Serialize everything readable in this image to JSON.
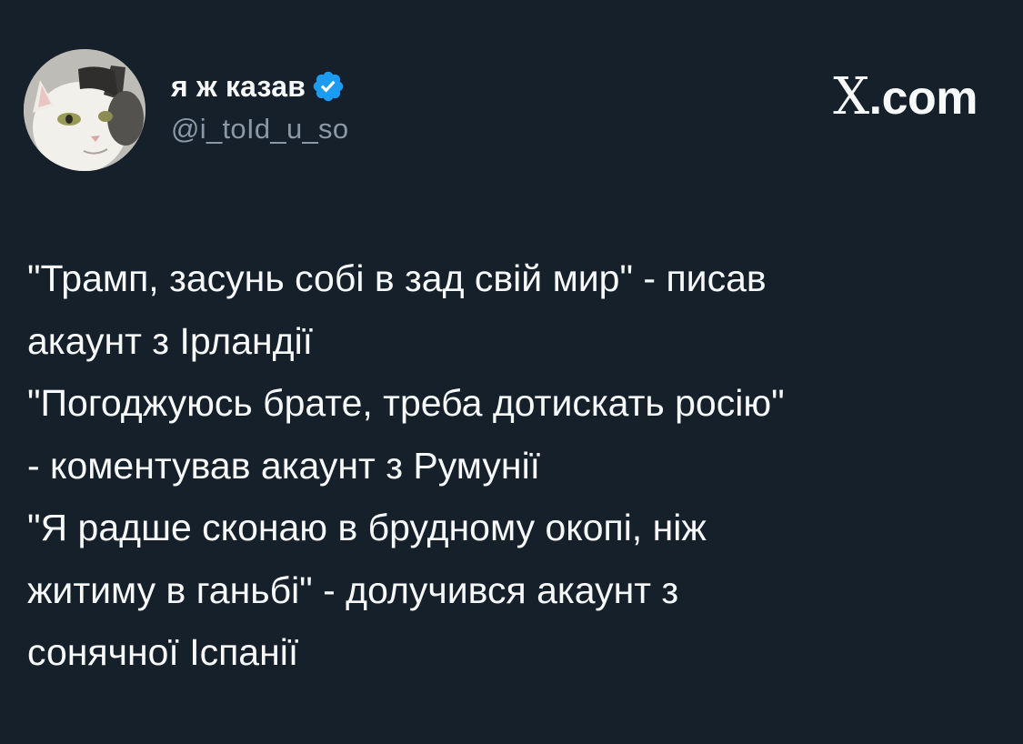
{
  "author": {
    "display_name": "я ж казав",
    "handle": "@i_toId_u_so",
    "verified": true,
    "avatar_icon": "cat-avatar-icon",
    "badge_icon": "verified-badge-icon",
    "badge_color": "#1d9bf0"
  },
  "brand": {
    "label": ".com",
    "logo_icon": "x-logo-icon",
    "logo_text": "X"
  },
  "tweet": {
    "lines": [
      "\"Трамп, засунь собі в зад свій мир\" - писав",
      "акаунт з Ірландії",
      "\"Погоджуюсь брате, треба дотискать росію\"",
      "- коментував акаунт з Румунії",
      "\"Я радше сконаю в брудному окопі, ніж",
      "житиму в ганьбі\" - долучився акаунт з",
      "сонячної Іспанії"
    ]
  },
  "colors": {
    "background": "#15202b",
    "text_primary": "#f7f9f9",
    "text_secondary": "#8b98a5"
  }
}
